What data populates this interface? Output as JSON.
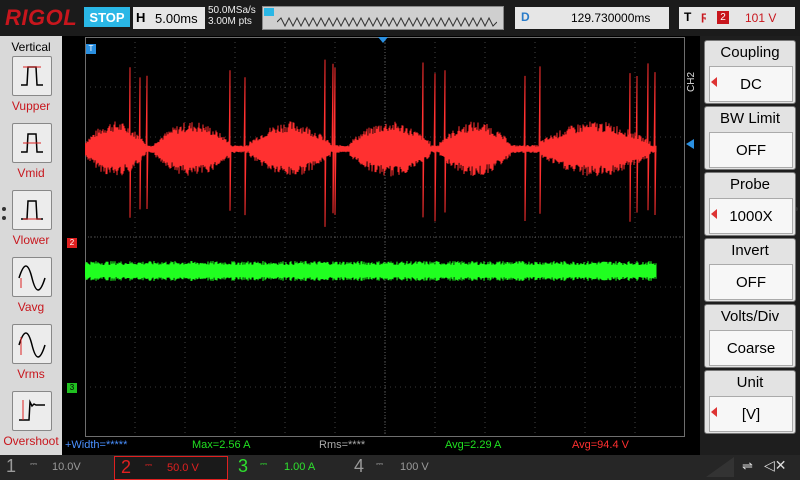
{
  "topbar": {
    "logo": "RIGOL",
    "run_state": "STOP",
    "horizontal": {
      "key": "H",
      "value": "5.00ms"
    },
    "sample_rate": "50.0MSa/s",
    "memory_depth": "3.00M pts",
    "delay": {
      "key": "D",
      "value": "129.730000ms"
    },
    "trigger": {
      "key": "T",
      "edge": "ϝ",
      "source": "2",
      "level": "101 V"
    }
  },
  "left_menu": {
    "title": "Vertical",
    "items": [
      {
        "label": "Vupper",
        "icon": "vupper-icon"
      },
      {
        "label": "Vmid",
        "icon": "vmid-icon"
      },
      {
        "label": "Vlower",
        "icon": "vlower-icon"
      },
      {
        "label": "Vavg",
        "icon": "vavg-icon"
      },
      {
        "label": "Vrms",
        "icon": "vrms-icon"
      },
      {
        "label": "Overshoot",
        "icon": "overshoot-icon"
      }
    ]
  },
  "right_menu": {
    "channel_tag": "CH2",
    "items": [
      {
        "title": "Coupling",
        "value": "DC"
      },
      {
        "title": "BW Limit",
        "value": "OFF"
      },
      {
        "title": "Probe",
        "value": "1000X"
      },
      {
        "title": "Invert",
        "value": "OFF"
      },
      {
        "title": "Volts/Div",
        "value": "Coarse"
      },
      {
        "title": "Unit",
        "value": "[V]"
      }
    ]
  },
  "measurements": {
    "width": "+Width=*****",
    "max": "Max=2.56 A",
    "rms": "Rms=****",
    "avg_ch3": "Avg=2.29 A",
    "avg_ch2": "Avg=94.4 V"
  },
  "markers": {
    "trigger_pos": "T",
    "ch2": "2",
    "ch3": "3"
  },
  "channels": [
    {
      "num": "1",
      "scale": "10.0V",
      "color": "#9a9a9a"
    },
    {
      "num": "2",
      "scale": "50.0 V",
      "color": "#e02020"
    },
    {
      "num": "3",
      "scale": "1.00 A",
      "color": "#2ee02e"
    },
    {
      "num": "4",
      "scale": "100 V",
      "color": "#9a9a9a"
    }
  ],
  "colors": {
    "ch2": "#ff3030",
    "ch3": "#20ff20",
    "ch1_marker": "#2a8fe0",
    "grid": "#6e6e6e"
  }
}
